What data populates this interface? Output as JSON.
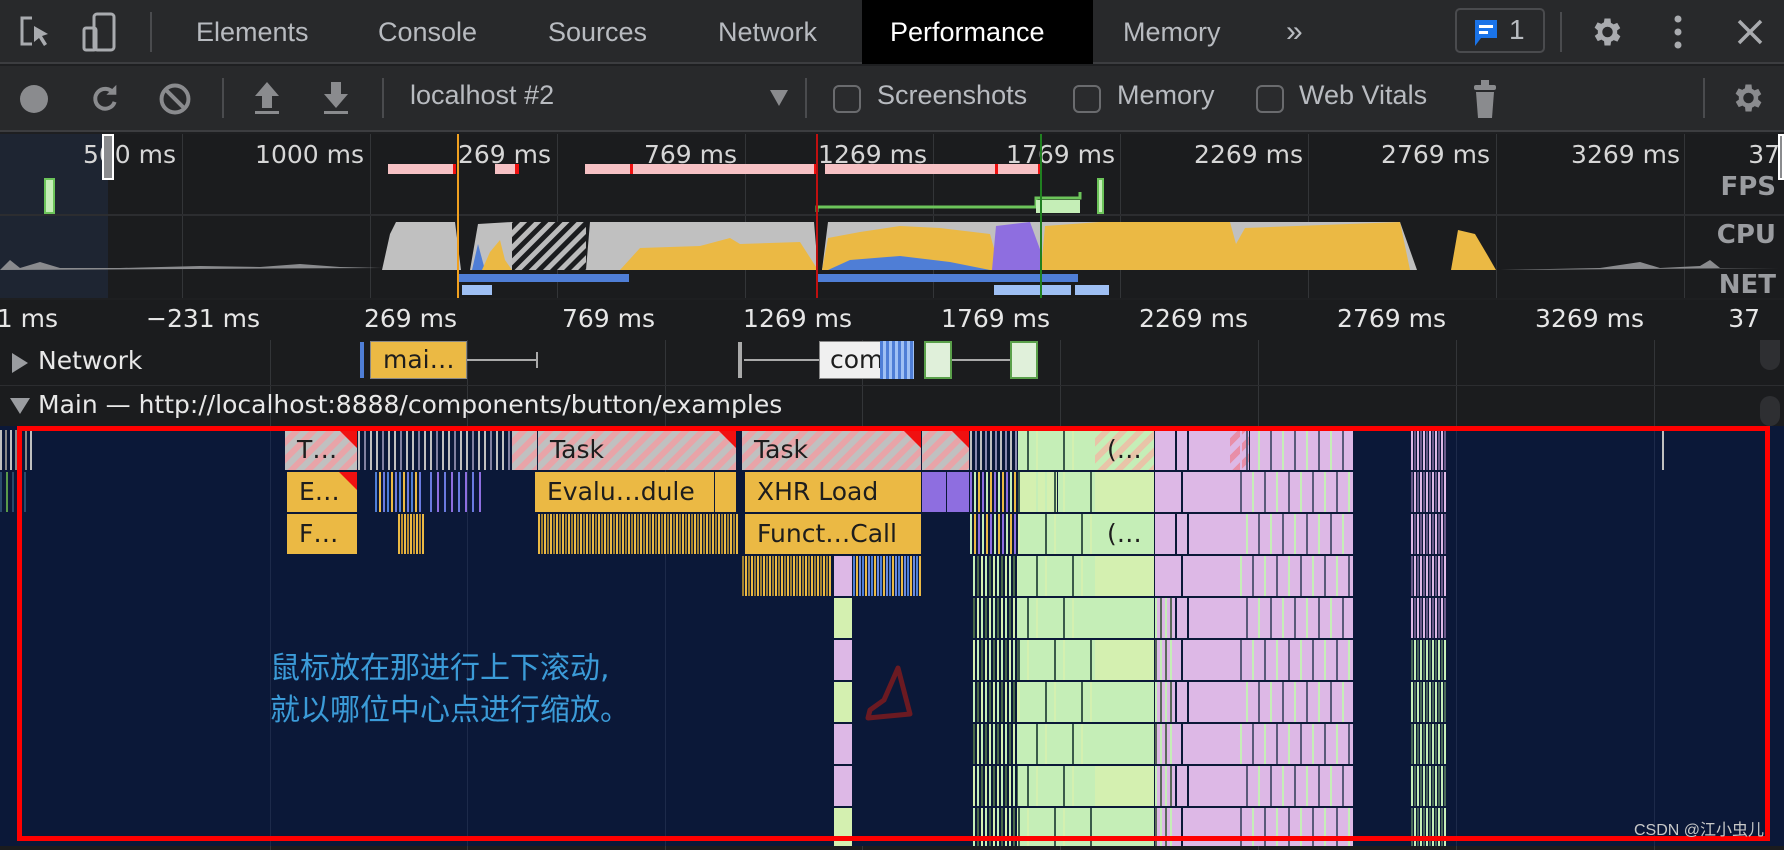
{
  "tabbar": {
    "tabs": [
      {
        "label": "Elements"
      },
      {
        "label": "Console"
      },
      {
        "label": "Sources"
      },
      {
        "label": "Network"
      },
      {
        "label": "Performance",
        "active": true
      },
      {
        "label": "Memory"
      }
    ],
    "more_tabs_label": "»",
    "issues_count": "1",
    "icons": [
      "inspect-element-icon",
      "device-toolbar-icon",
      "issues-icon",
      "settings-icon",
      "more-vert-icon",
      "close-icon"
    ]
  },
  "toolbar": {
    "profile_select": "localhost #2",
    "checkboxes": [
      {
        "label": "Screenshots",
        "checked": false
      },
      {
        "label": "Memory",
        "checked": false
      },
      {
        "label": "Web Vitals",
        "checked": false
      }
    ],
    "icons": [
      "record-icon",
      "reload-icon",
      "clear-icon",
      "upload-icon",
      "download-icon",
      "dropdown-arrow-icon",
      "trash-icon",
      "settings-icon"
    ]
  },
  "overview": {
    "ticks": [
      "500 ms",
      "1000 ms",
      "269 ms",
      "769 ms",
      "1269 ms",
      "1769 ms",
      "2269 ms",
      "2769 ms",
      "3269 ms",
      "37"
    ],
    "labels": {
      "fps": "FPS",
      "cpu": "CPU",
      "net": "NET"
    },
    "colors": {
      "scripting": "#ebb944",
      "rendering": "#8e6ee0",
      "loading": "#4f7ed6",
      "other": "#c0c0c0",
      "long_task": "#f6c1c4"
    }
  },
  "ruler": {
    "ticks": [
      "1 ms",
      "−231 ms",
      "269 ms",
      "769 ms",
      "1269 ms",
      "1769 ms",
      "2269 ms",
      "2769 ms",
      "3269 ms",
      "37"
    ]
  },
  "tracks": {
    "network": {
      "label": "Network",
      "requests": [
        "mai…",
        "com"
      ]
    },
    "main": {
      "label": "Main — http://localhost:8888/components/button/examples"
    }
  },
  "flame": {
    "row1": [
      "T…",
      "Task",
      "Task",
      "(…"
    ],
    "row2": [
      "E…",
      "Evalu…dule",
      "XHR Load"
    ],
    "row3": [
      "F…",
      "Funct…Call",
      "(…"
    ]
  },
  "annotation": {
    "line1": "鼠标放在那进行上下滚动,",
    "line2": "就以哪位中心点进行缩放。",
    "highlight_color": "#ff0000"
  },
  "watermark": "CSDN @江小虫儿"
}
